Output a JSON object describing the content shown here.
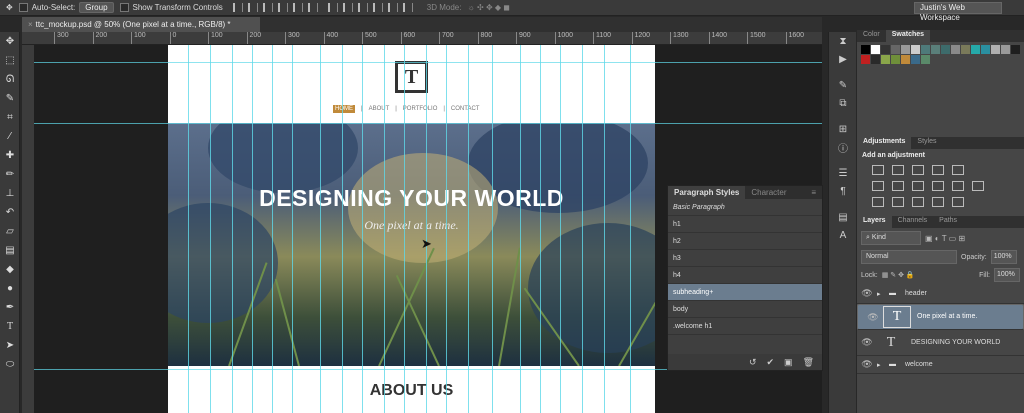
{
  "options_bar": {
    "auto_select_label": "Auto-Select:",
    "auto_select_value": "Group",
    "show_transform_label": "Show Transform Controls",
    "mode_3d_label": "3D Mode:",
    "workspace": "Justin's Web Workspace"
  },
  "document": {
    "tab_title": "ttc_mockup.psd @ 50% (One pixel at a time., RGB/8) *",
    "ruler_ticks": [
      "300",
      "200",
      "100",
      "0",
      "100",
      "200",
      "300",
      "400",
      "500",
      "600",
      "700",
      "800",
      "900",
      "1000",
      "1100",
      "1200",
      "1300",
      "1400",
      "1500",
      "1600"
    ]
  },
  "mockup": {
    "logo_letter": "T",
    "nav": [
      "HOME",
      "ABOUT",
      "PORTFOLIO",
      "CONTACT"
    ],
    "nav_sep": "|",
    "hero_title": "DESIGNING YOUR WORLD",
    "hero_subtitle": "One pixel at a time.",
    "about_title": "ABOUT US"
  },
  "paragraph_styles": {
    "tabs": [
      "Paragraph Styles",
      "Character"
    ],
    "rows": [
      "Basic Paragraph",
      "h1",
      "h2",
      "h3",
      "h4",
      "subheading+",
      "body",
      ".welcome h1"
    ],
    "selected": "subheading+"
  },
  "color_panel": {
    "tabs": [
      "Color",
      "Swatches"
    ],
    "swatches": [
      "#000000",
      "#ffffff",
      "#333333",
      "#666666",
      "#999999",
      "#cccccc",
      "#4e7a7a",
      "#5a7f7a",
      "#3d6b6b",
      "#8a8a8a",
      "#7a7a5a",
      "#25a9a9",
      "#2a8fa0",
      "#b0b0b0",
      "#9a9a9a",
      "#1f1f1f",
      "#c02020",
      "#2a2a2a",
      "#8aa64a",
      "#6f8f3a",
      "#c08a3a",
      "#3a6a8a",
      "#5a8a6a"
    ]
  },
  "adjustments": {
    "tabs": [
      "Adjustments",
      "Styles"
    ],
    "add_label": "Add an adjustment"
  },
  "layers": {
    "tabs": [
      "Layers",
      "Channels",
      "Paths"
    ],
    "kind_label": "Kind",
    "blend_mode": "Normal",
    "opacity_label": "Opacity:",
    "opacity_value": "100%",
    "lock_label": "Lock:",
    "fill_label": "Fill:",
    "fill_value": "100%",
    "items": [
      {
        "name": "header",
        "type": "group"
      },
      {
        "name": "One pixel at a time.",
        "type": "text",
        "selected": true
      },
      {
        "name": "DESIGNING YOUR WORLD",
        "type": "text"
      },
      {
        "name": "welcome",
        "type": "group"
      }
    ]
  }
}
